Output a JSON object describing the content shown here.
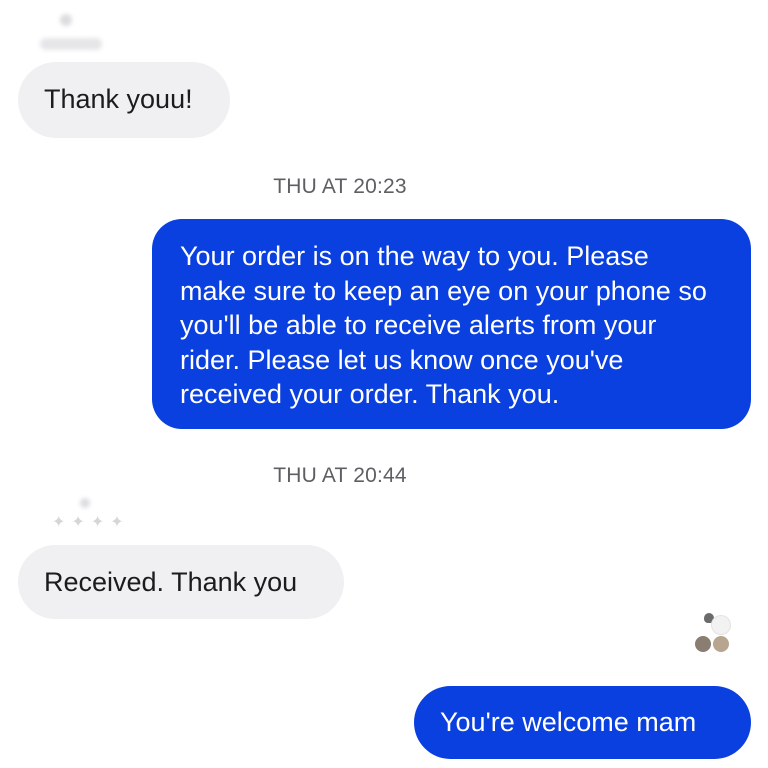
{
  "messages": [
    {
      "direction": "incoming",
      "text": "Thank youu!"
    },
    {
      "direction": "outgoing",
      "text": "Your order is on the way to you. Please make sure to keep an eye on your phone so you'll be able to receive alerts from your rider. Please let us know once you've received your order. Thank you."
    },
    {
      "direction": "incoming",
      "text": "Received. Thank you"
    },
    {
      "direction": "outgoing",
      "text": "You're welcome mam"
    }
  ],
  "timestamps": [
    "THU AT 20:23",
    "THU AT 20:44"
  ],
  "colors": {
    "outgoing_bubble": "#0a3fe0",
    "incoming_bubble": "#f0f0f2",
    "outgoing_text": "#ffffff",
    "incoming_text": "#1c1c1e",
    "timestamp_text": "#5f5f63"
  },
  "icons": {
    "read_receipt": "seen-avatars-icon",
    "sender": "blurred-sender-avatar"
  }
}
